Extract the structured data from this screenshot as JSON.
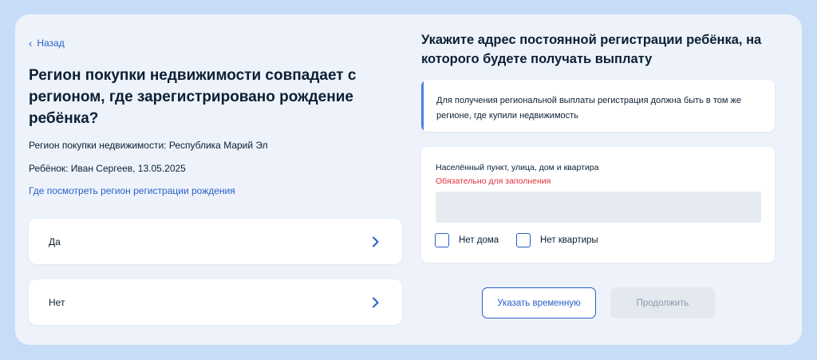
{
  "nav": {
    "back_label": "Назад"
  },
  "question": {
    "title": "Регион покупки недвижимости совпадает с регионом, где зарегистрировано рождение ребёнка?",
    "region_line": "Регион покупки недвижимости: Республика Марий Эл",
    "child_line": "Ребёнок: Иван Сергеев, 13.05.2025",
    "help_link": "Где посмотреть регион регистрации рождения"
  },
  "options": [
    {
      "label": "Да"
    },
    {
      "label": "Нет"
    }
  ],
  "address": {
    "title": "Укажите адрес постоянной регистрации ребёнка, на которого будете получать выплату",
    "notice": "Для получения региональной выплаты регистрация должна быть в том же регионе, где купили недвижимость",
    "field_label": "Населённый пункт, улица, дом и квартира",
    "field_error": "Обязательно для заполнения",
    "field_value": "",
    "no_house_label": "Нет дома",
    "no_flat_label": "Нет квартиры"
  },
  "actions": {
    "temp_label": "Указать временную",
    "continue_label": "Продолжить"
  },
  "colors": {
    "accent": "#2a5fc7",
    "error": "#e0303a",
    "notice_bar": "#4a7fe0",
    "outer_bg": "#c7dcf7",
    "page_bg": "#eef3fb"
  }
}
